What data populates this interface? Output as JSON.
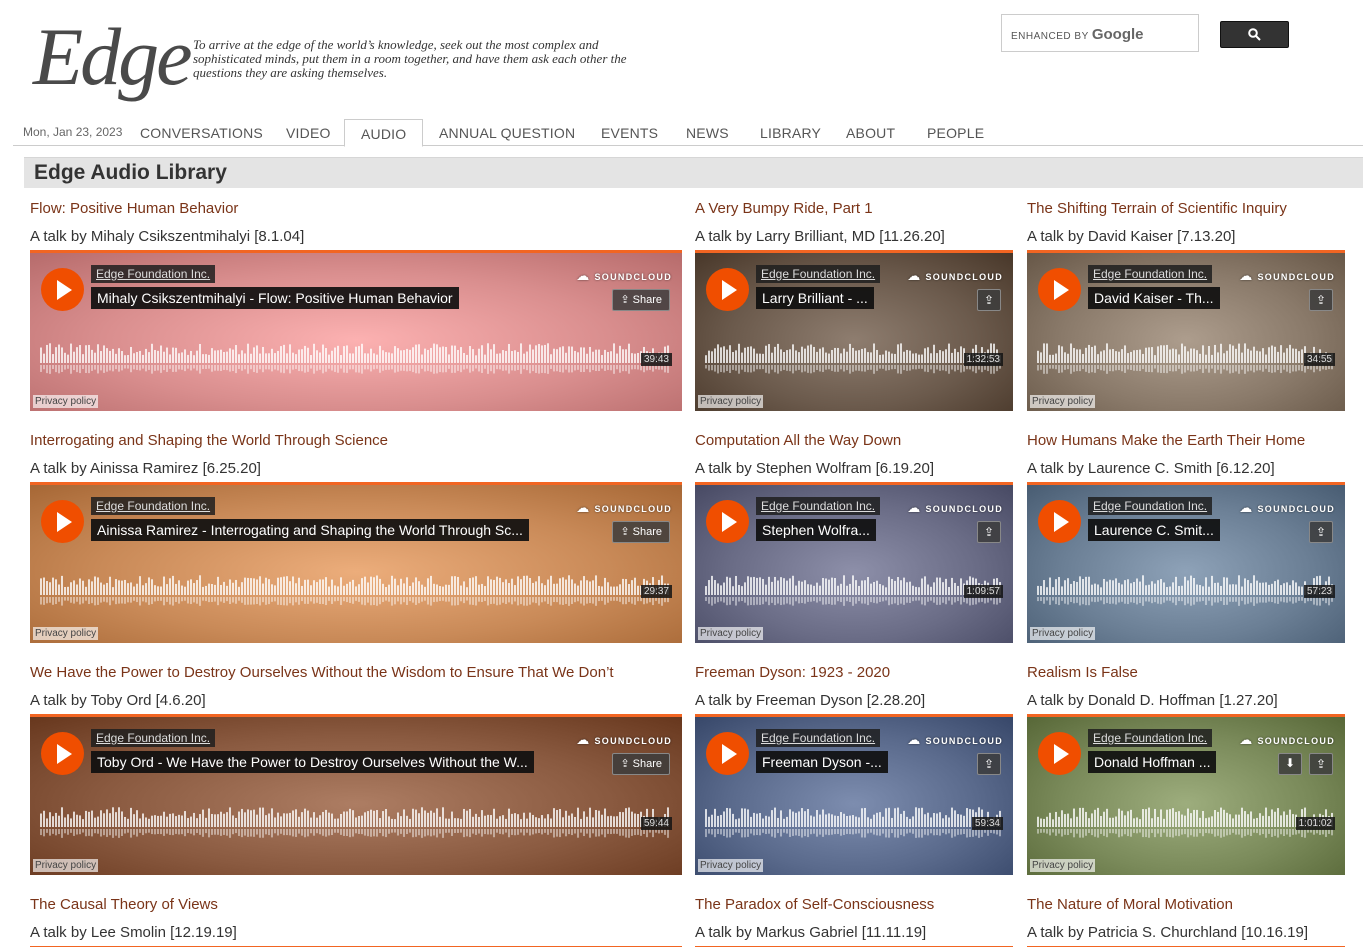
{
  "header": {
    "logo_text": "Edge",
    "tagline": "To arrive at the edge of the world’s knowledge, seek out the most complex and sophisticated minds, put them in a room together, and have them ask each other the questions they are asking themselves.",
    "search": {
      "enhanced_label": "ENHANCED BY",
      "google_label": "Google",
      "button_icon": "search-icon"
    }
  },
  "nav": {
    "date": "Mon, Jan 23, 2023",
    "items": [
      "CONVERSATIONS",
      "VIDEO",
      "AUDIO",
      "ANNUAL QUESTION",
      "EVENTS",
      "NEWS",
      "LIBRARY",
      "ABOUT",
      "PEOPLE"
    ],
    "active": "AUDIO"
  },
  "section": {
    "title": "Edge Audio Library"
  },
  "player_common": {
    "uploader": "Edge Foundation Inc.",
    "soundcloud_label": "SOUNDCLOUD",
    "share_label": "Share",
    "privacy_label": "Privacy policy"
  },
  "cards": [
    {
      "title": "Flow: Positive Human Behavior",
      "byline": "A talk by Mihaly Csikszentmihalyi [8.1.04]",
      "track": "Mihaly Csikszentmihalyi - Flow: Positive Human Behavior",
      "duration": "39:43",
      "bg": "#d98e8e",
      "progress": 0
    },
    {
      "title": "A Very Bumpy Ride, Part 1",
      "byline": "A talk by Larry Brilliant, MD [11.26.20]",
      "track": "Larry Brilliant - ...",
      "duration": "1:32:53",
      "bg": "#6b5a4c",
      "progress": 0
    },
    {
      "title": "The Shifting Terrain of Scientific Inquiry",
      "byline": "A talk by David Kaiser [7.13.20]",
      "track": "David Kaiser - Th...",
      "duration": "34:55",
      "bg": "#8a7a6a",
      "progress": 0
    },
    {
      "title": "Interrogating and Shaping the World Through Science",
      "byline": "A talk by Ainissa Ramirez [6.25.20]",
      "track": "Ainissa Ramirez - Interrogating and Shaping the World Through Sc...",
      "duration": "29:37",
      "bg": "#c98a58",
      "progress": 0
    },
    {
      "title": "Computation All the Way Down",
      "byline": "A talk by Stephen Wolfram [6.19.20]",
      "track": "Stephen Wolfra...",
      "duration": "1:09:57",
      "bg": "#6a6c86",
      "progress": 0
    },
    {
      "title": "How Humans Make the Earth Their Home",
      "byline": "A talk by Laurence C. Smith [6.12.20]",
      "track": "Laurence C. Smit...",
      "duration": "57:23",
      "bg": "#6b7f95",
      "progress": 0
    },
    {
      "title": "We Have the Power to Destroy Ourselves Without the Wisdom to Ensure That We Don’t",
      "byline": "A talk by Toby Ord [4.6.20]",
      "track": "Toby Ord - We Have the Power to Destroy Ourselves Without the W...",
      "duration": "59:44",
      "bg": "#8a5a40",
      "progress": 0
    },
    {
      "title": "Freeman Dyson: 1923 - 2020",
      "byline": "A talk by Freeman Dyson [2.28.20]",
      "track": "Freeman Dyson -...",
      "duration": "59:34",
      "bg": "#5a6a8c",
      "progress": 0
    },
    {
      "title": "Realism Is False",
      "byline": "A talk by Donald D. Hoffman [1.27.20]",
      "track": "Donald Hoffman ...",
      "duration": "1:01:02",
      "bg": "#7a8a5a",
      "progress": 0
    },
    {
      "title": "The Causal Theory of Views",
      "byline": "A talk by Lee Smolin [12.19.19]"
    },
    {
      "title": "The Paradox of Self-Consciousness",
      "byline": "A talk by Markus Gabriel [11.11.19]"
    },
    {
      "title": "The Nature of Moral Motivation",
      "byline": "A talk by Patricia S. Churchland [10.16.19]"
    }
  ]
}
